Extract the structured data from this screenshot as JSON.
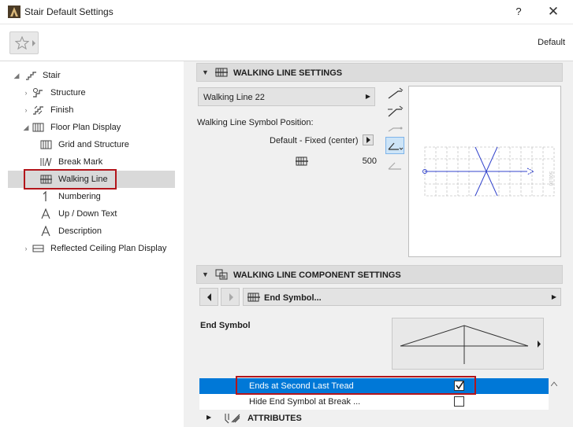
{
  "window": {
    "title": "Stair Default Settings",
    "help": "?",
    "close": "✕"
  },
  "toolbar": {
    "favorites_icon": "star-icon",
    "default_label": "Default"
  },
  "tree": {
    "items": [
      {
        "label": "Stair",
        "icon": "stair-icon",
        "expander": "chevron-down"
      },
      {
        "label": "Structure",
        "icon": "structure-icon",
        "expander": "chevron-right"
      },
      {
        "label": "Finish",
        "icon": "finish-icon",
        "expander": "chevron-right"
      },
      {
        "label": "Floor Plan Display",
        "icon": "floor-plan-icon",
        "expander": "chevron-down"
      },
      {
        "label": "Grid and Structure",
        "icon": "grid-icon"
      },
      {
        "label": "Break Mark",
        "icon": "break-mark-icon"
      },
      {
        "label": "Walking Line",
        "icon": "walking-line-icon",
        "selected": true
      },
      {
        "label": "Numbering",
        "icon": "numbering-icon"
      },
      {
        "label": "Up / Down Text",
        "icon": "text-a-icon"
      },
      {
        "label": "Description",
        "icon": "text-a-icon"
      },
      {
        "label": "Reflected Ceiling Plan Display",
        "icon": "ceiling-plan-icon",
        "expander": "chevron-right"
      }
    ]
  },
  "walking_line_settings": {
    "title": "WALKING LINE SETTINGS",
    "line_type": "Walking Line 22",
    "symbol_position_label": "Walking Line Symbol Position:",
    "symbol_position_value": "Default - Fixed (center)",
    "offset_value": "500",
    "preview_dimension_text": "500,00"
  },
  "component_settings": {
    "title": "WALKING LINE COMPONENT SETTINGS",
    "component_value": "End Symbol...",
    "section_label": "End Symbol",
    "rows": [
      {
        "label": "Ends at Second Last Tread",
        "checked": true,
        "selected": true
      },
      {
        "label": "Hide End Symbol at Break ...",
        "checked": false,
        "selected": false
      }
    ],
    "attributes_label": "ATTRIBUTES"
  },
  "colors": {
    "accent": "#0078d7",
    "highlight": "#b3151b",
    "selected_row": "#d9d9d9"
  }
}
